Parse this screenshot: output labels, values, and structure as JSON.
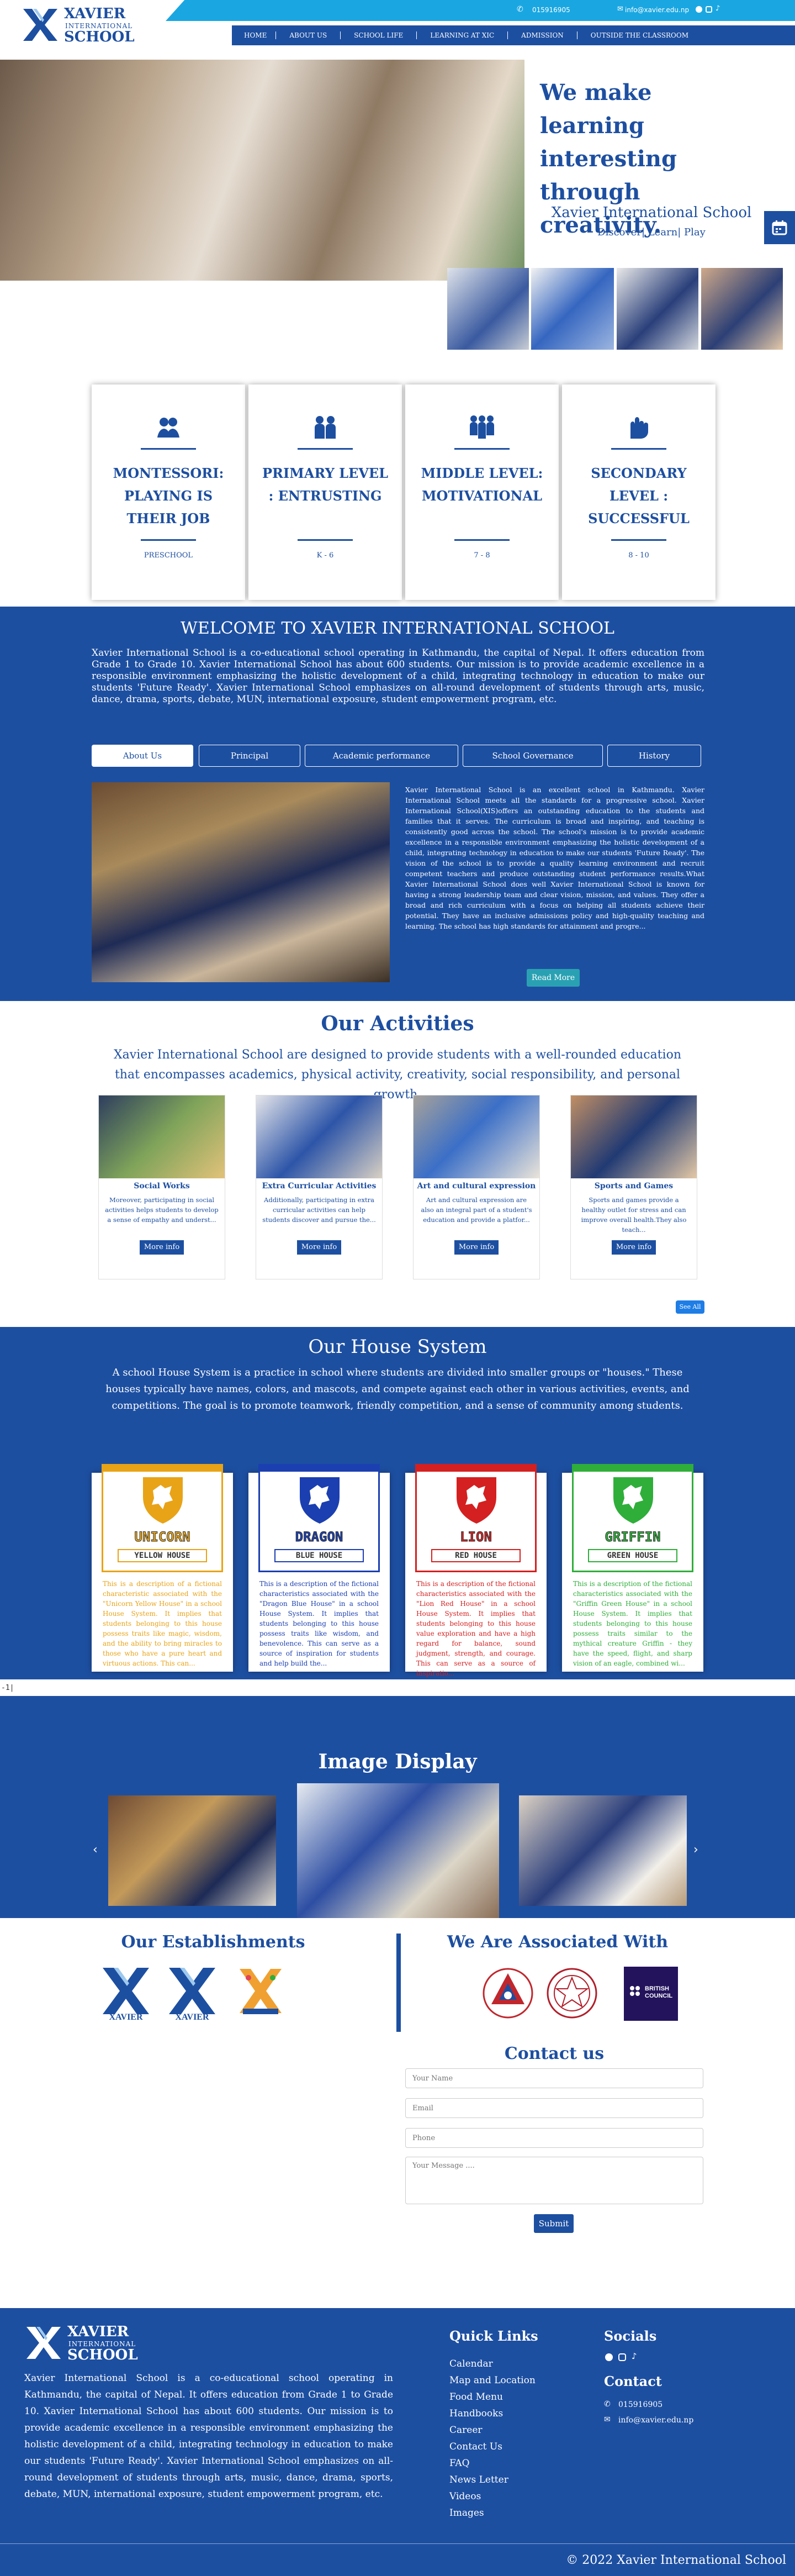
{
  "brand": {
    "line1": "XAVIER",
    "line2": "INTERNATIONAL",
    "line3": "SCHOOL"
  },
  "topbar": {
    "phone": "015916905",
    "email": "info@xavier.edu.np"
  },
  "nav": [
    "HOME",
    "ABOUT US",
    "SCHOOL LIFE",
    "LEARNING AT XIC",
    "ADMISSION",
    "OUTSIDE THE CLASSROOM"
  ],
  "hero": {
    "headline": "We make learning interesting through creativity.",
    "school": "Xavier International School",
    "tagline": "Discover| Learn| Play"
  },
  "levels": [
    {
      "title": "MONTESSORI: PLAYING IS THEIR JOB",
      "sub": "PRESCHOOL"
    },
    {
      "title": "PRIMARY LEVEL : ENTRUSTING",
      "sub": "K - 6"
    },
    {
      "title": "MIDDLE LEVEL: MOTIVATIONAL",
      "sub": "7 - 8"
    },
    {
      "title": "SECONDARY LEVEL : SUCCESSFUL",
      "sub": "8 - 10"
    }
  ],
  "welcome": {
    "title": "WELCOME TO XAVIER INTERNATIONAL SCHOOL",
    "text": "Xavier International School is a co-educational school operating in Kathmandu, the capital of Nepal. It offers education from Grade 1 to Grade 10. Xavier International School has about 600 students. Our mission is to provide academic excellence in a responsible environment emphasizing the holistic development of a child, integrating technology in education to make our students 'Future Ready'. Xavier International School emphasizes on all-round development of students through arts, music, dance, drama, sports, debate, MUN, international exposure, student empowerment program, etc.",
    "tabs": [
      "About Us",
      "Principal",
      "Academic performance",
      "School Governance",
      "History"
    ],
    "about": "Xavier International School is an excellent school in Kathmandu. Xavier International School meets all the standards for a progressive school. Xavier International School(XIS)offers an outstanding education to the students and families that it serves. The curriculum is broad and inspiring, and teaching is consistently good across the school. The school's mission is to provide academic excellence in a responsible environment emphasizing the holistic development of a child, integrating technology in education to make our students 'Future Ready'. The vision of the school is to provide a quality learning environment and recruit competent teachers and produce outstanding student performance results.What Xavier International School does well Xavier International School is known for having a strong leadership team and clear vision, mission, and values. They offer a broad and rich curriculum with a focus on helping all students achieve their potential. They have an inclusive admissions policy and high-quality teaching and learning. The school has high standards for attainment and progre...",
    "read_more": "Read More"
  },
  "activities": {
    "title": "Our Activities",
    "intro": "Xavier International School are designed to provide students with a well-rounded education that encompasses academics, physical activity, creativity, social responsibility, and personal growth.",
    "items": [
      {
        "title": "Social Works",
        "text": "Moreover, participating in social activities helps students to develop a sense of empathy and underst..."
      },
      {
        "title": "Extra Curricular Activities",
        "text": "Additionally, participating in extra curricular activities can help students discover and pursue the..."
      },
      {
        "title": "Art and cultural expression",
        "text": "Art and cultural expression are also an integral part of a student's education and provide a platfor..."
      },
      {
        "title": "Sports and Games",
        "text": "Sports and games provide a healthy outlet for stress and can improve overall health.They also teach..."
      }
    ],
    "more": "More info",
    "see_all": "See All"
  },
  "house": {
    "title": "Our House System",
    "intro": "A school House System is a  practice in school where students are divided into smaller groups or \"houses.\" These houses typically have names, colors, and mascots, and compete against each other in various activities, events, and competitions. The goal is to promote teamwork, friendly competition, and a sense of community among students.",
    "items": [
      {
        "name": "UNICORN",
        "house": "YELLOW HOUSE",
        "color": "#e8a317",
        "text": "This is a description of a fictional characteristic associated with the \"Unicorn Yellow House\" in a school House System. It implies that students belonging to this house possess traits like magic, wisdom, and the ability to bring miracles to those who have a pure heart and virtuous actions. This can..."
      },
      {
        "name": "DRAGON",
        "house": "BLUE HOUSE",
        "color": "#1b3fb0",
        "text": "This is a description of the fictional characteristics associated with the \"Dragon Blue House\" in a school House System. It implies that students belonging to this house possess traits like wisdom, and benevolence. This can serve as a source of inspiration for students and help build the..."
      },
      {
        "name": "LION",
        "house": "RED HOUSE",
        "color": "#d42020",
        "text": "This is a description of the fictional characteristics associated with the \"Lion Red House\" in a school House System. It implies that students belonging to this house value exploration and have a high regard for balance, sound judgment, strength, and courage. This can serve as a source of inspiratio..."
      },
      {
        "name": "GRIFFIN",
        "house": "GREEN HOUSE",
        "color": "#2fae3a",
        "text": "This is a description of the fictional characteristics associated with the \"Griffin Green House\" in a school House System. It implies that students belonging to this house possess traits similar to the mythical creature Griffin - they have the speed, flight, and sharp vision of an eagle, combined wi..."
      }
    ]
  },
  "stray": "-1|",
  "gallery": {
    "title": "Image Display"
  },
  "establishments": {
    "title": "Our Establishments"
  },
  "associated": {
    "title": "We Are Associated With",
    "british": "BRITISH COUNCIL"
  },
  "contact": {
    "title": "Contact us",
    "name": "Your Name",
    "email": "Email",
    "phone": "Phone",
    "message": "Your Message ....",
    "submit": "Submit"
  },
  "footer": {
    "about": "Xavier International School is a co-educational school operating in Kathmandu, the capital of Nepal. It offers education from Grade 1 to Grade 10. Xavier International School has about 600 students. Our mission is to provide academic excellence in a responsible environment emphasizing the holistic development of a child, integrating technology in education to make our students 'Future Ready'. Xavier International School emphasizes on all-round development of students through arts, music, dance, drama, sports, debate, MUN, international exposure, student empowerment program, etc.",
    "quick_title": "Quick Links",
    "quick": [
      "Calendar",
      "Map and Location",
      "Food Menu",
      "Handbooks",
      "Career",
      "Contact Us",
      "FAQ",
      "News Letter",
      "Videos",
      "Images"
    ],
    "socials_title": "Socials",
    "contact_title": "Contact",
    "phone": "015916905",
    "email": "info@xavier.edu.np",
    "copyright": "© 2022 Xavier International School"
  }
}
